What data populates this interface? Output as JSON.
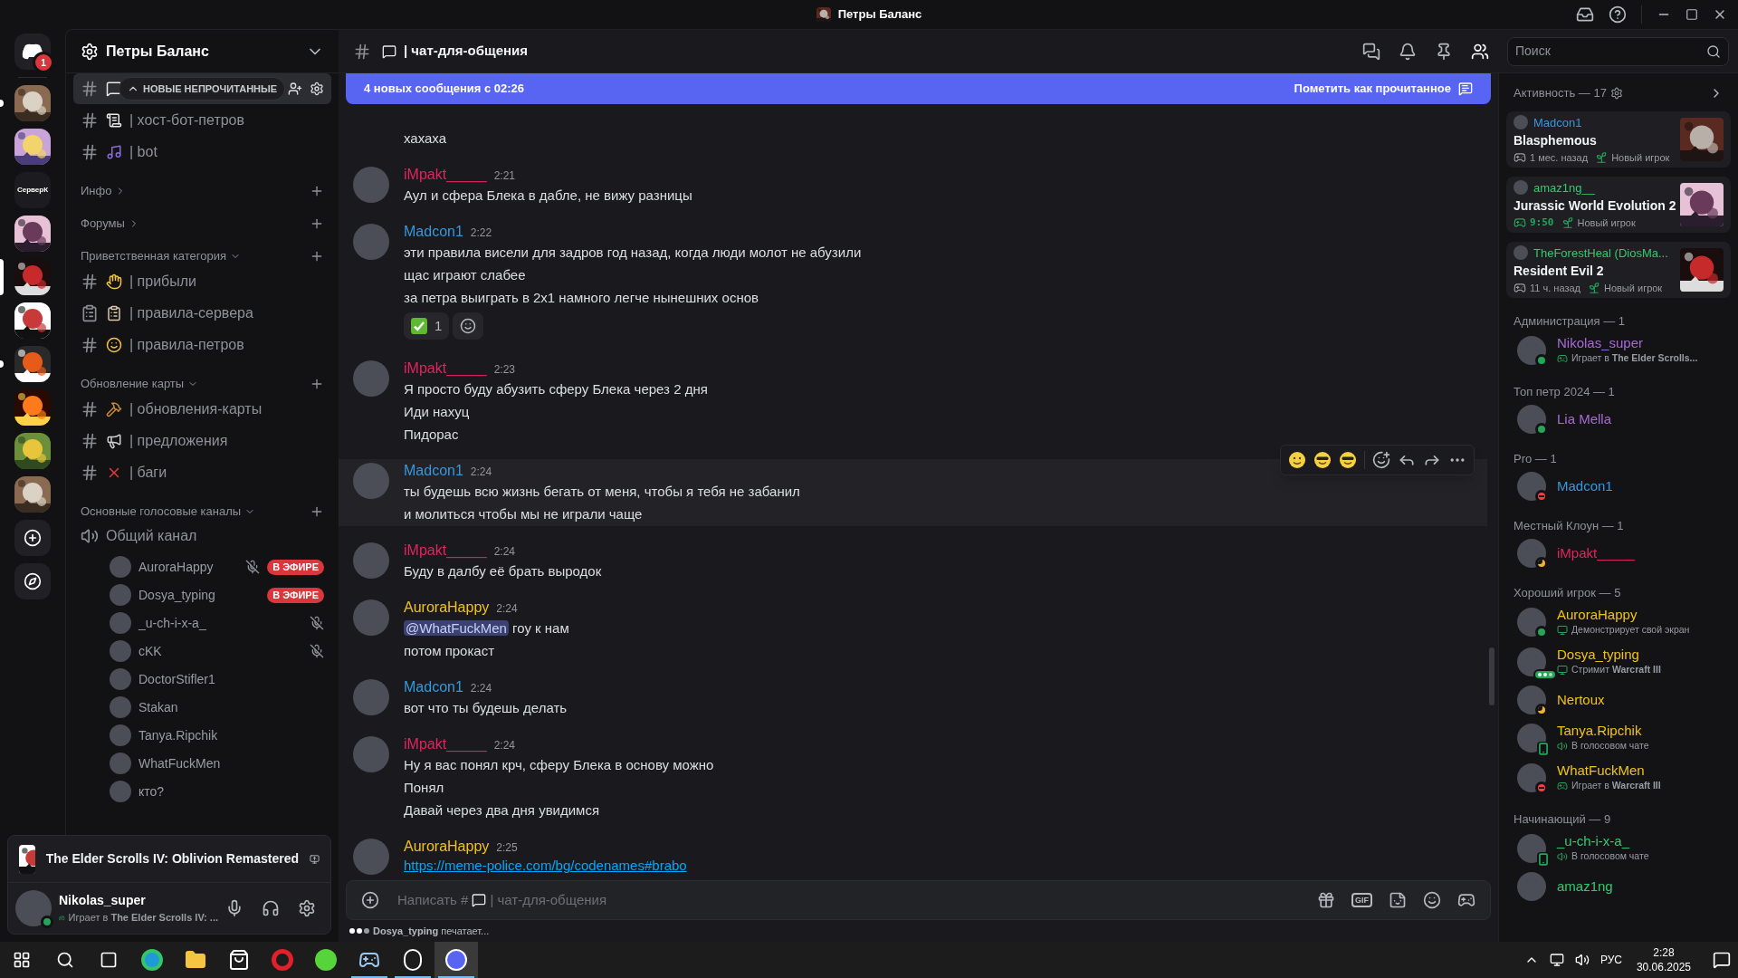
{
  "title_bar": {
    "title": "Петры Баланс"
  },
  "servers": [
    {
      "kind": "home",
      "badge": "1",
      "selected": false,
      "unread": false
    },
    {
      "kind": "picture",
      "selected": false,
      "unread": true
    },
    {
      "kind": "picture",
      "selected": false,
      "unread": false
    },
    {
      "kind": "text",
      "label": "СерверК",
      "selected": false,
      "unread": false
    },
    {
      "kind": "picture",
      "selected": false,
      "unread": false
    },
    {
      "kind": "picture",
      "selected": true,
      "unread": false
    },
    {
      "kind": "picture",
      "selected": false,
      "unread": false
    },
    {
      "kind": "picture",
      "selected": false,
      "unread": true
    },
    {
      "kind": "picture",
      "selected": false,
      "unread": false
    },
    {
      "kind": "picture",
      "selected": false,
      "unread": false
    },
    {
      "kind": "picture",
      "selected": false,
      "unread": false
    },
    {
      "kind": "add",
      "selected": false,
      "unread": false
    },
    {
      "kind": "discover",
      "selected": false,
      "unread": false
    }
  ],
  "sidebar": {
    "server_name": "Петры Баланс",
    "unread_pill": "НОВЫЕ НЕПРОЧИТАННЫЕ",
    "channels": [
      {
        "kind": "text",
        "selected": true
      },
      {
        "kind": "text",
        "name": "| хост-бот-петров",
        "selected": false
      },
      {
        "kind": "text",
        "name": "| bot",
        "selected": false
      }
    ],
    "categories": [
      {
        "name": "Инфо",
        "expanded": false
      },
      {
        "name": "Форумы",
        "expanded": false
      },
      {
        "name": "Приветственная категория",
        "expanded": true,
        "channels": [
          {
            "kind": "text",
            "name": "| прибыли",
            "selected": false
          },
          {
            "kind": "rules",
            "name": "| правила-сервера",
            "selected": false
          },
          {
            "kind": "text",
            "name": "| правила-петров",
            "selected": false
          }
        ]
      },
      {
        "name": "Обновление карты",
        "expanded": true,
        "channels": [
          {
            "kind": "text",
            "name": "| обновления-карты",
            "selected": false
          },
          {
            "kind": "text",
            "name": "| предложения",
            "selected": false
          },
          {
            "kind": "text",
            "name": "| баги",
            "selected": false
          }
        ]
      },
      {
        "name": "Основные голосовые каналы",
        "expanded": true,
        "channels": [
          {
            "kind": "voice",
            "name": "Общий канал",
            "selected": false,
            "users": [
              {
                "name": "AuroraHappy",
                "muted": true,
                "live": "В ЭФИРЕ"
              },
              {
                "name": "Dosya_typing",
                "muted": false,
                "live": "В ЭФИРЕ"
              },
              {
                "name": "_u-ch-i-x-a_",
                "muted": true
              },
              {
                "name": "cKK",
                "muted": true
              },
              {
                "name": "DoctorStifler1",
                "muted": false
              },
              {
                "name": "Stakan",
                "muted": false
              },
              {
                "name": "Tanya.Ripchik",
                "muted": false
              },
              {
                "name": "WhatFuckMen",
                "muted": false
              },
              {
                "name": "кто?",
                "muted": false
              }
            ]
          }
        ]
      }
    ],
    "activity": {
      "game": "The Elder Scrolls IV: Oblivion Remastered"
    },
    "user": {
      "name": "Nikolas_super",
      "kind": "online",
      "activity": "Играет в **The Elder Scrolls IV: ...**"
    }
  },
  "chat": {
    "channel_name": "| чат-для-общения",
    "search_placeholder": "Поиск",
    "banner": {
      "text": "4 новых сообщения с 02:26",
      "action": "Пометить как прочитанное"
    },
    "messages": [
      {
        "lines": [
          "хахаха"
        ],
        "hovered": false
      },
      {
        "author": "iMpakt_____",
        "color": "#e0245e",
        "time": "2:21",
        "lines": [
          "Аул и сфера Блека в дабле, не вижу разницы"
        ],
        "hovered": false
      },
      {
        "author": "Madcon1",
        "color": "#3498db",
        "time": "2:22",
        "lines": [
          "эти правила висели для задров год назад, когда люди молот не абузили",
          "щас играют слабее",
          "за петра выиграть в 2х1 намного легче нынешних основ"
        ],
        "reactions": [
          {
            "count": "1",
            "selected": false
          }
        ],
        "hovered": false
      },
      {
        "author": "iMpakt_____",
        "color": "#e0245e",
        "time": "2:23",
        "lines": [
          "Я просто буду абузить сферу Блека через 2 дня",
          "Иди нахуц",
          "Пидорас"
        ],
        "hovered": false
      },
      {
        "author": "Madcon1",
        "color": "#3498db",
        "time": "2:24",
        "lines": [
          "ты будешь всю жизнь бегать от меня, чтобы я тебя не забанил",
          "и молиться чтобы мы не играли чаще"
        ],
        "hovered": true
      },
      {
        "author": "iMpakt_____",
        "color": "#e0245e",
        "time": "2:24",
        "lines": [
          "Буду в далбу её брать выродок"
        ],
        "hovered": false
      },
      {
        "author": "AuroraHappy",
        "color": "#f1c40f",
        "time": "2:24",
        "lines": [
          {
            "kind": "mention",
            "mention": "@WhatFuckMen",
            "text": "гоу к нам"
          },
          "потом прокаст"
        ],
        "hovered": false
      },
      {
        "author": "Madcon1",
        "color": "#3498db",
        "time": "2:24",
        "lines": [
          "вот что ты будешь делать"
        ],
        "hovered": false
      },
      {
        "author": "iMpakt_____",
        "color": "#e0245e",
        "time": "2:24",
        "lines": [
          "Ну я вас понял крч, сферу Блека в основу можно",
          "Понял",
          "Давай через два дня увидимся"
        ],
        "hovered": false
      },
      {
        "author": "AuroraHappy",
        "color": "#f1c40f",
        "time": "2:25",
        "lines": [
          {
            "kind": "link",
            "text": "https://meme-police.com/bg/codenames#brabo"
          }
        ],
        "hovered": false
      }
    ],
    "composer": {
      "placeholder": "Написать #",
      "channel": "| чат-для-общения",
      "gif": "GIF"
    },
    "typing": "**Dosya_typing** печатает..."
  },
  "members": {
    "activity_header": "Активность — 17",
    "activity_cards": [
      {
        "user": "Madcon1",
        "color": "#3498db",
        "game": "Blasphemous",
        "time": "1 мес. назад",
        "tag": "Новый игрок",
        "live": false
      },
      {
        "user": "amaz1ng__",
        "color": "#2ecc71",
        "game": "Jurassic World Evolution 2",
        "time": "9:50",
        "tag": "Новый игрок",
        "live": true
      },
      {
        "user": "TheForestHeal (DiosMa...",
        "color": "#2ecc71",
        "game": "Resident Evil 2",
        "time": "11 ч. назад",
        "tag": "Новый игрок",
        "live": false
      }
    ],
    "groups": [
      {
        "title": "Администрация — 1",
        "members": [
          {
            "name": "Nikolas_super",
            "color": "#a66bd3",
            "kind": "online",
            "activity": {
              "kind": "game",
              "text": "Играет в **The Elder Scrolls...**"
            }
          }
        ]
      },
      {
        "title": "Топ петр 2024 — 1",
        "members": [
          {
            "name": "Lia Mella",
            "color": "#a66bd3",
            "kind": "online"
          }
        ]
      },
      {
        "title": "Pro — 1",
        "members": [
          {
            "name": "Madcon1",
            "color": "#3498db",
            "kind": "dnd"
          }
        ]
      },
      {
        "title": "Местный Клоун — 1",
        "members": [
          {
            "name": "iMpakt_____",
            "color": "#e0245e",
            "kind": "idle"
          }
        ]
      },
      {
        "title": "Хороший игрок — 5",
        "members": [
          {
            "name": "AuroraHappy",
            "color": "#f1c40f",
            "kind": "online",
            "activity": {
              "kind": "screen",
              "text": "Демонстрирует свой экран"
            }
          },
          {
            "name": "Dosya_typing",
            "color": "#f1c40f",
            "kind": "typing",
            "activity": {
              "kind": "screen",
              "text": "Стримит **Warcraft III**"
            }
          },
          {
            "name": "Nertoux",
            "color": "#f1c40f",
            "kind": "idle"
          },
          {
            "name": "Tanya.Ripchik",
            "color": "#f1c40f",
            "kind": "mobile",
            "activity": {
              "kind": "voice",
              "text": "В голосовом чате"
            }
          },
          {
            "name": "WhatFuckMen",
            "color": "#f1c40f",
            "kind": "dnd",
            "activity": {
              "kind": "game",
              "text": "Играет в **Warcraft III**"
            }
          }
        ]
      },
      {
        "title": "Начинающий — 9",
        "members": [
          {
            "name": "_u-ch-i-x-a_",
            "color": "#2ecc71",
            "kind": "mobile",
            "activity": {
              "kind": "voice",
              "text": "В голосовом чате"
            }
          },
          {
            "name": "amaz1ng",
            "color": "#2ecc71"
          }
        ]
      }
    ]
  },
  "taskbar": {
    "apps": [
      {
        "running": false,
        "selected": false
      },
      {
        "running": false,
        "selected": false
      },
      {
        "running": false,
        "selected": false
      },
      {
        "running": false,
        "selected": false
      },
      {
        "running": false,
        "selected": false
      },
      {
        "running": true,
        "selected": false
      },
      {
        "running": true,
        "selected": false
      },
      {
        "running": true,
        "selected": true
      }
    ],
    "language": "РУС",
    "time": "2:28",
    "date": "30.06.2025"
  }
}
